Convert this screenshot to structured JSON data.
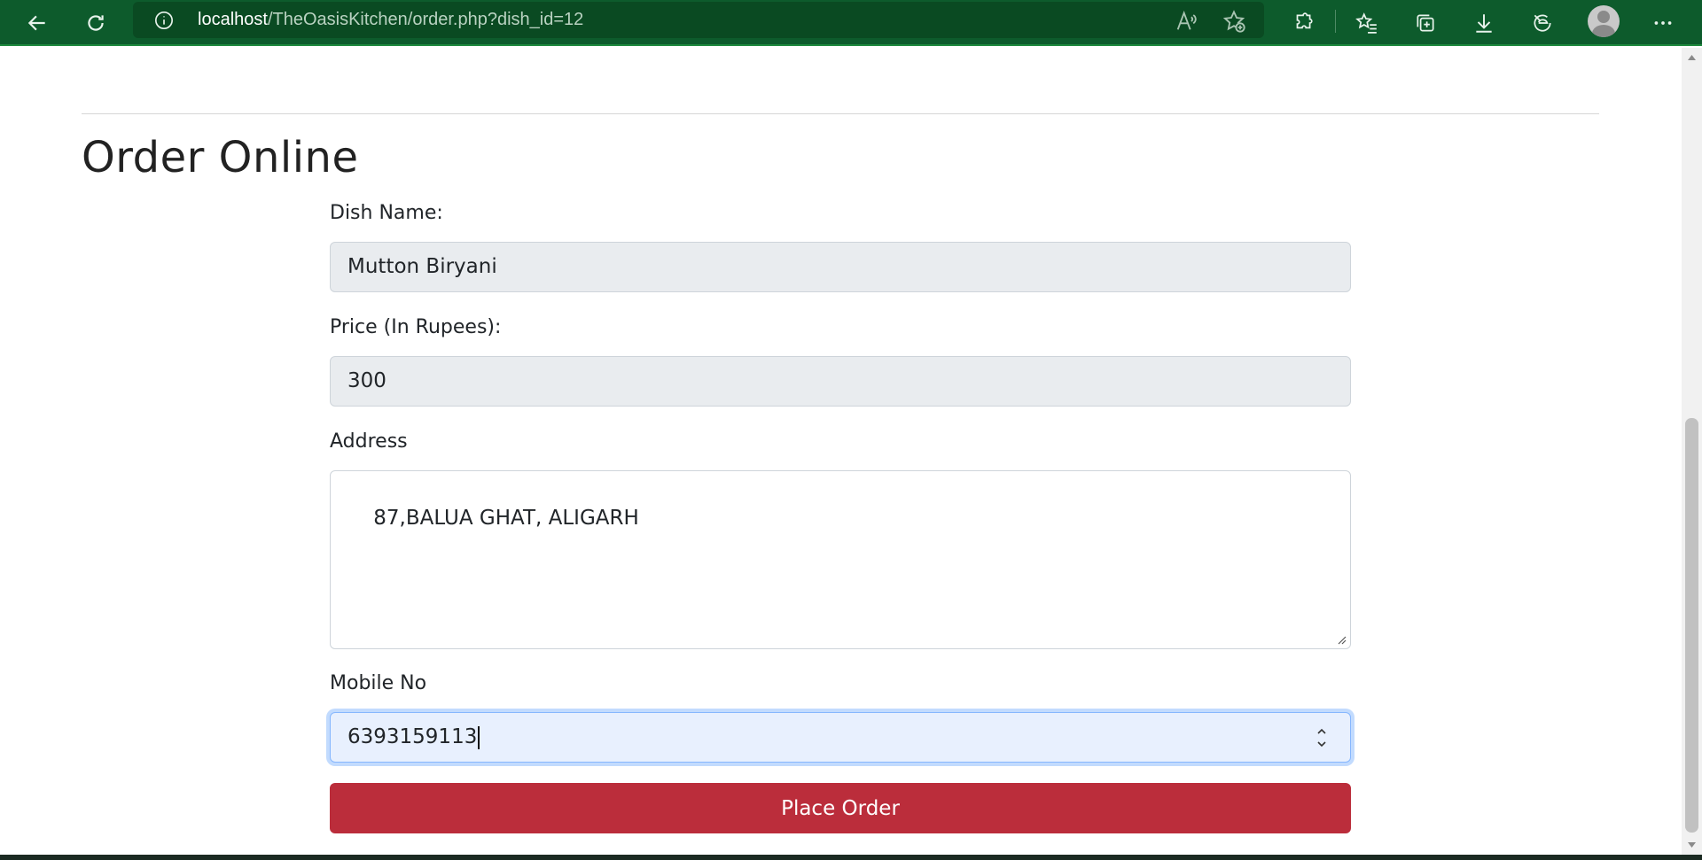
{
  "browser": {
    "url_host": "localhost",
    "url_path": "/TheOasisKitchen/order.php?dish_id=12",
    "icons": [
      "back-arrow-icon",
      "refresh-icon",
      "info-icon",
      "read-aloud-icon",
      "add-favorite-icon",
      "extensions-icon",
      "favorites-icon",
      "collections-icon",
      "downloads-icon",
      "browser-essentials-icon",
      "profile-avatar-icon",
      "more-icon"
    ]
  },
  "page": {
    "title": "Order Online"
  },
  "form": {
    "dish_name_label": "Dish Name:",
    "dish_name_value": "Mutton Biryani",
    "price_label": "Price (In Rupees):",
    "price_value": "300",
    "address_label": "Address",
    "address_value": "87,BALUA GHAT, ALIGARH",
    "mobile_label": "Mobile No",
    "mobile_value": "6393159113",
    "submit_label": "Place Order"
  },
  "colors": {
    "toolbar": "#0d5b2c",
    "submit_button": "#bb2d3b",
    "readonly_field": "#e9ecef",
    "focused_field": "#e8f0fe"
  }
}
